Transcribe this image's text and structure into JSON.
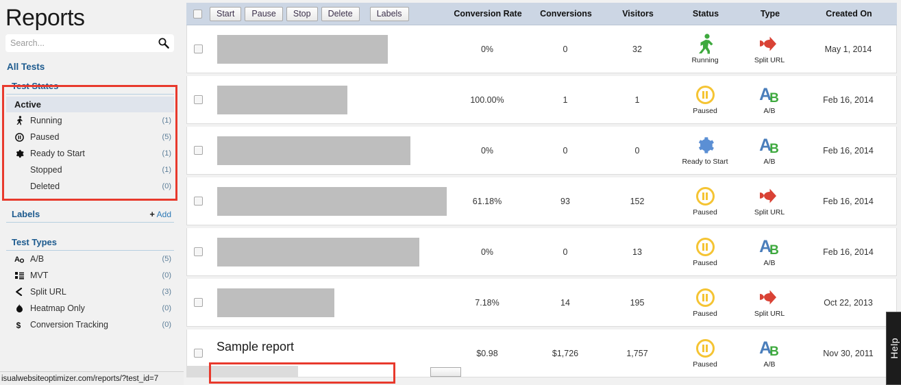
{
  "sidebar": {
    "title": "Reports",
    "search": {
      "placeholder": "Search...",
      "value": "",
      "icon": "search-icon"
    },
    "all_tests_label": "All Tests",
    "test_states": {
      "heading": "Test States",
      "active_label": "Active",
      "items": [
        {
          "label": "Running",
          "count": "(1)",
          "icon": "running-man-icon"
        },
        {
          "label": "Paused",
          "count": "(5)",
          "icon": "pause-circle-icon"
        },
        {
          "label": "Ready to Start",
          "count": "(1)",
          "icon": "gear-icon"
        },
        {
          "label": "Stopped",
          "count": "(1)",
          "icon": ""
        },
        {
          "label": "Deleted",
          "count": "(0)",
          "icon": ""
        }
      ]
    },
    "labels": {
      "heading": "Labels",
      "add_label": "Add",
      "add_plus": "+"
    },
    "test_types": {
      "heading": "Test Types",
      "items": [
        {
          "label": "A/B",
          "count": "(5)",
          "icon": "ab-test-icon"
        },
        {
          "label": "MVT",
          "count": "(0)",
          "icon": "grid-list-icon"
        },
        {
          "label": "Split URL",
          "count": "(3)",
          "icon": "chevron-left-icon"
        },
        {
          "label": "Heatmap Only",
          "count": "(0)",
          "icon": "flame-icon"
        },
        {
          "label": "Conversion Tracking",
          "count": "(0)",
          "icon": "dollar-icon"
        }
      ]
    }
  },
  "statusbar": {
    "url": "isualwebsiteoptimizer.com/reports/?test_id=7"
  },
  "toolbar": {
    "select_all_checkbox": "select-all",
    "buttons": [
      "Start",
      "Pause",
      "Stop",
      "Delete",
      "Labels"
    ],
    "columns": [
      "Conversion Rate",
      "Conversions",
      "Visitors",
      "Status",
      "Type",
      "Created On"
    ]
  },
  "rows": [
    {
      "name": "",
      "redacted": true,
      "redact_width": 249,
      "conversion_rate": "0%",
      "conversions": "0",
      "visitors": "32",
      "status": "Running",
      "status_icon": "running-man-icon",
      "type": "Split URL",
      "type_icon": "split-url-icon",
      "created_on": "May 1, 2014"
    },
    {
      "name": "",
      "redacted": true,
      "redact_width": 190,
      "conversion_rate": "100.00%",
      "conversions": "1",
      "visitors": "1",
      "status": "Paused",
      "status_icon": "pause-circle-icon",
      "type": "A/B",
      "type_icon": "ab-test-icon",
      "created_on": "Feb 16, 2014"
    },
    {
      "name": "",
      "redacted": true,
      "redact_width": 282,
      "conversion_rate": "0%",
      "conversions": "0",
      "visitors": "0",
      "status": "Ready to Start",
      "status_icon": "gear-icon",
      "type": "A/B",
      "type_icon": "ab-test-icon",
      "created_on": "Feb 16, 2014"
    },
    {
      "name": "",
      "redacted": true,
      "redact_width": 336,
      "conversion_rate": "61.18%",
      "conversions": "93",
      "visitors": "152",
      "status": "Paused",
      "status_icon": "pause-circle-icon",
      "type": "Split URL",
      "type_icon": "split-url-icon",
      "created_on": "Feb 16, 2014"
    },
    {
      "name": "",
      "redacted": true,
      "redact_width": 295,
      "conversion_rate": "0%",
      "conversions": "0",
      "visitors": "13",
      "status": "Paused",
      "status_icon": "pause-circle-icon",
      "type": "A/B",
      "type_icon": "ab-test-icon",
      "created_on": "Feb 16, 2014"
    },
    {
      "name": "",
      "redacted": true,
      "redact_width": 171,
      "conversion_rate": "7.18%",
      "conversions": "14",
      "visitors": "195",
      "status": "Paused",
      "status_icon": "pause-circle-icon",
      "type": "Split URL",
      "type_icon": "split-url-icon",
      "created_on": "Oct 22, 2013"
    },
    {
      "name": "Sample report",
      "redacted": false,
      "redact_width": 0,
      "conversion_rate": "$0.98",
      "conversions": "$1,726",
      "visitors": "1,757",
      "status": "Paused",
      "status_icon": "pause-circle-icon",
      "type": "A/B",
      "type_icon": "ab-test-icon",
      "created_on": "Nov 30, 2011"
    }
  ],
  "help_tab": {
    "label": "Help"
  },
  "colors": {
    "annotation_red": "#e8392c",
    "toolbar_blue": "#ccd6e4",
    "sidebar_bg": "#f1f1f1",
    "link_blue": "#1c5a8e",
    "running_green": "#3ea93e",
    "paused_yellow": "#f5c433",
    "ready_blue": "#5b8fd4",
    "split_url_red": "#d94235",
    "redaction_gray": "#bebebe"
  }
}
